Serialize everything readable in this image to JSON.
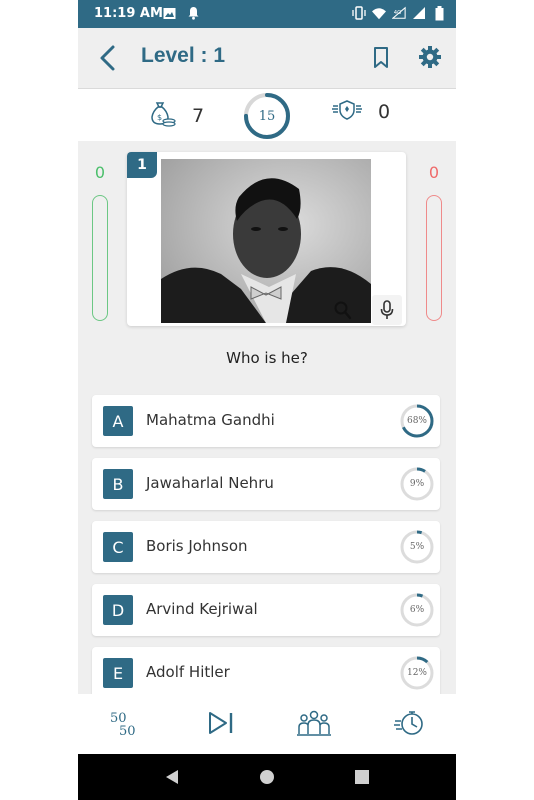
{
  "status": {
    "time": "11:19 AM"
  },
  "header": {
    "title": "Level : 1"
  },
  "stats": {
    "coins": "7",
    "timer": "15",
    "shields": "0"
  },
  "scores": {
    "correct": "0",
    "wrong": "0"
  },
  "question": {
    "number": "1",
    "text": "Who is he?"
  },
  "options": [
    {
      "letter": "A",
      "text": "Mahatma Gandhi",
      "percent_label": "68%",
      "percent": 68
    },
    {
      "letter": "B",
      "text": "Jawaharlal Nehru",
      "percent_label": "9%",
      "percent": 9
    },
    {
      "letter": "C",
      "text": "Boris Johnson",
      "percent_label": "5%",
      "percent": 5
    },
    {
      "letter": "D",
      "text": "Arvind Kejriwal",
      "percent_label": "6%",
      "percent": 6
    },
    {
      "letter": "E",
      "text": "Adolf Hitler",
      "percent_label": "12%",
      "percent": 12
    }
  ],
  "tools": {
    "fifty_fifty": "50 50"
  },
  "colors": {
    "accent": "#2f6a85",
    "correct": "#4bbf6b",
    "wrong": "#ef6a6a"
  },
  "icons": [
    "back-icon",
    "bookmark-icon",
    "gear-icon",
    "money-bag-icon",
    "shield-icon",
    "zoom-icon",
    "mic-icon",
    "skip-icon",
    "audience-icon",
    "timer-icon"
  ]
}
